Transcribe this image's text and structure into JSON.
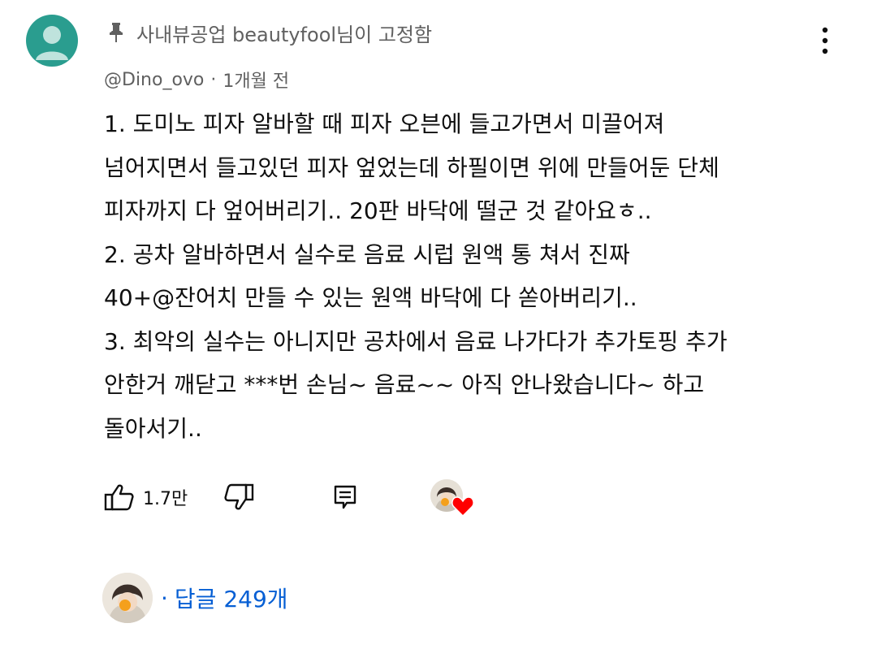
{
  "pinned": {
    "label": "사내뷰공업 beautyfool님이 고정함",
    "icon": "pin-icon"
  },
  "comment": {
    "author": "@Dino_ovo",
    "separator": "·",
    "time": "1개월 전",
    "lines": [
      "1. 도미노 피자 알바할 때 피자 오븐에 들고가면서 미끌어져",
      "넘어지면서 들고있던 피자 엎었는데 하필이면 위에 만들어둔 단체",
      "피자까지 다 엎어버리기.. 20판 바닥에 떨군 것 같아요ㅎ..",
      "2. 공차 알바하면서 실수로 음료 시럽 원액 통 쳐서 진짜",
      "40+@잔어치 만들 수 있는 원액 바닥에 다 쏟아버리기..",
      "3. 최악의 실수는 아니지만 공차에서 음료 나가다가 추가토핑 추가",
      "안한거 깨닫고 ***번 손님~ 음료~~ 아직 안나왔습니다~ 하고",
      "돌아서기.."
    ]
  },
  "actions": {
    "like_count": "1.7만",
    "icons": [
      "thumbs-up-icon",
      "thumbs-down-icon",
      "reply-icon",
      "creator-heart-icon"
    ]
  },
  "replies": {
    "separator": "·",
    "label": "답글 249개"
  },
  "colors": {
    "avatar_bg": "#2a9d8f",
    "secondary_text": "#606060",
    "link_blue": "#065fd4",
    "heart_red": "#ff0000"
  }
}
